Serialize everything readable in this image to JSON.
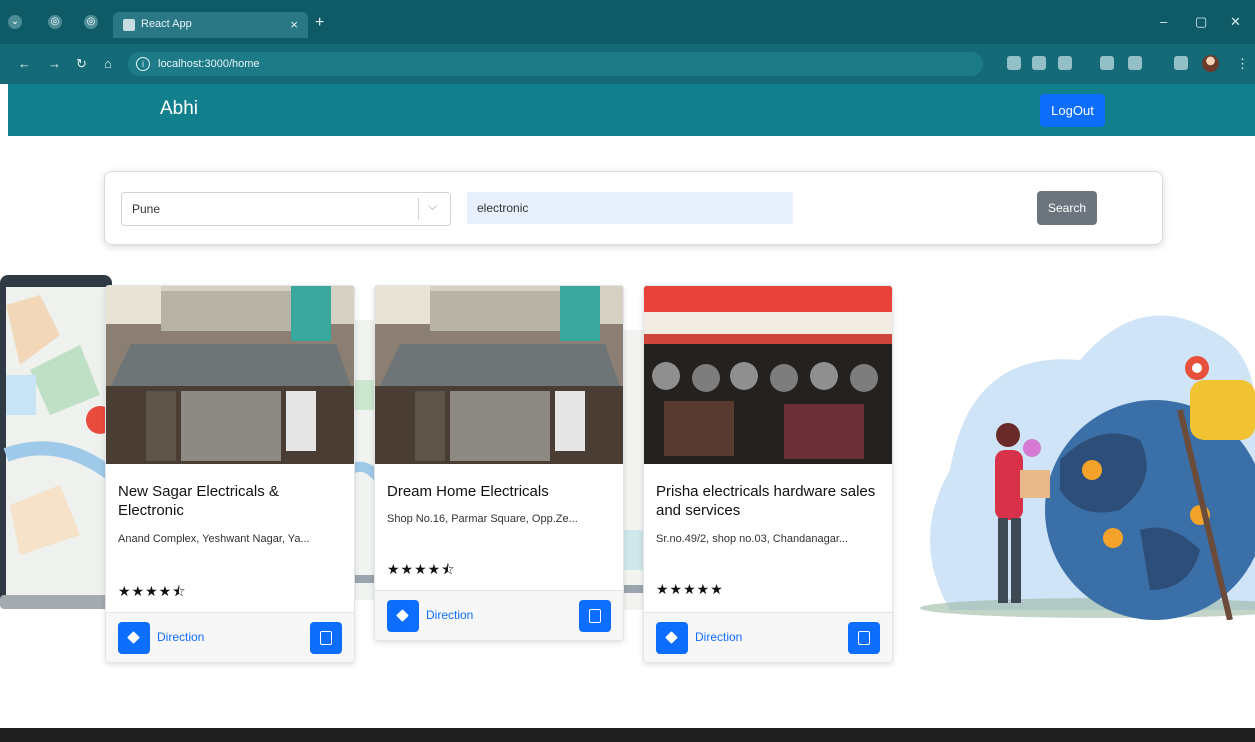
{
  "browser": {
    "tab_title": "React App",
    "tab_close": "×",
    "new_tab": "+",
    "url": "localhost:3000/home",
    "window_min": "–",
    "window_max": "▢",
    "window_close": "✕"
  },
  "header": {
    "brand": "Abhi",
    "logout_label": "LogOut"
  },
  "search": {
    "city_value": "Pune",
    "query_value": "electronic",
    "button_label": "Search"
  },
  "cards": [
    {
      "name": "New Sagar Electricals & Electronic",
      "address": "Anand Complex, Yeshwant Nagar, Ya...",
      "rating_stars": "★★★★⯪",
      "direction_label": "Direction"
    },
    {
      "name": "Dream Home Electricals",
      "address": "Shop No.16, Parmar Square, Opp.Ze...",
      "rating_stars": "★★★★⯪",
      "direction_label": "Direction"
    },
    {
      "name": "Prisha electricals hardware sales and services",
      "address": "Sr.no.49/2, shop no.03, Chandanagar...",
      "rating_stars": "★★★★★",
      "direction_label": "Direction"
    }
  ],
  "colors": {
    "header_bg": "#127f8d",
    "browser_bg": "#0e5a66",
    "primary": "#0d6efd",
    "search_button": "#6c757d"
  }
}
